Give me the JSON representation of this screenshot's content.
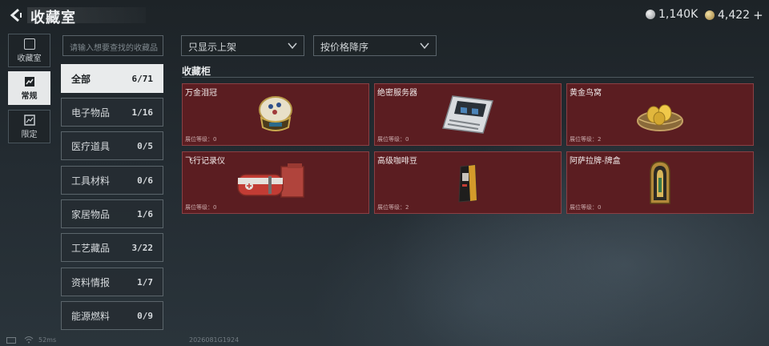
{
  "header": {
    "title": "收藏室",
    "currencies": [
      {
        "icon": "silver-coin-icon",
        "value": "1,140K"
      },
      {
        "icon": "gold-coin-icon",
        "value": "4,422"
      }
    ],
    "add_symbol": "+"
  },
  "side_tabs": [
    {
      "label": "收藏室",
      "icon": "collection-room-icon",
      "active": false
    },
    {
      "label": "常规",
      "icon": "regular-icon",
      "active": true
    },
    {
      "label": "限定",
      "icon": "limited-icon",
      "active": false
    }
  ],
  "search": {
    "placeholder": "请输入想要查找的收藏品"
  },
  "filters": {
    "shelf_filter": "只显示上架",
    "sort": "按价格降序"
  },
  "categories": [
    {
      "label": "全部",
      "count": "6/71",
      "active": true
    },
    {
      "label": "电子物品",
      "count": "1/16"
    },
    {
      "label": "医疗道具",
      "count": "0/5"
    },
    {
      "label": "工具材料",
      "count": "0/6"
    },
    {
      "label": "家居物品",
      "count": "1/6"
    },
    {
      "label": "工艺藏品",
      "count": "3/22"
    },
    {
      "label": "资料情报",
      "count": "1/7"
    },
    {
      "label": "能源燃料",
      "count": "0/9"
    }
  ],
  "cabinet": {
    "title": "收藏柜",
    "level_label": "展位等级：",
    "items": [
      {
        "name": "万金泪冠",
        "level": "0",
        "icon": "gem-egg-icon"
      },
      {
        "name": "绝密服务器",
        "level": "0",
        "icon": "server-icon"
      },
      {
        "name": "黄金鸟窝",
        "level": "2",
        "icon": "golden-nest-icon"
      },
      {
        "name": "飞行记录仪",
        "level": "0",
        "icon": "flight-recorder-icon"
      },
      {
        "name": "高级咖啡豆",
        "level": "2",
        "icon": "coffee-bag-icon"
      },
      {
        "name": "阿萨拉牌-牌盒",
        "level": "0",
        "icon": "card-box-icon"
      }
    ]
  },
  "footer": {
    "ping": "52ms",
    "build": "2026081G1924"
  }
}
